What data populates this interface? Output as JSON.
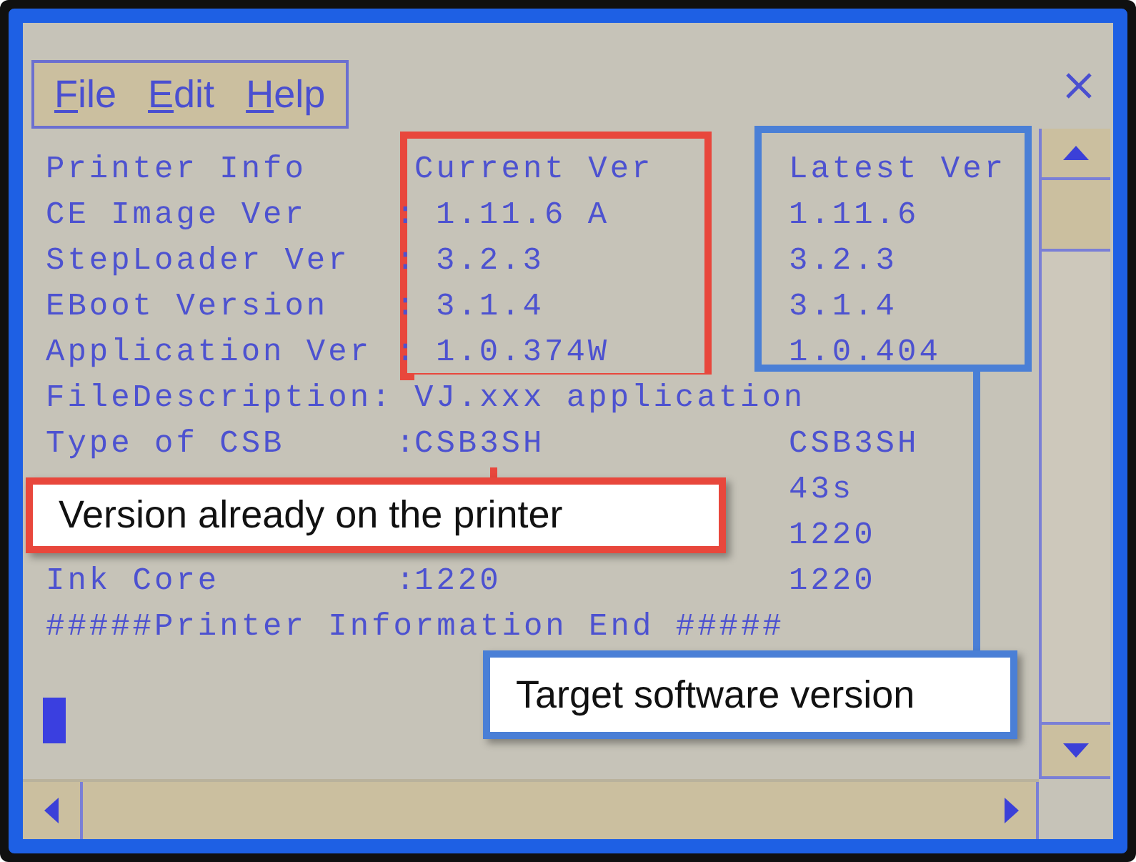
{
  "menu": [
    {
      "label": "File"
    },
    {
      "label": "Edit"
    },
    {
      "label": "Help"
    }
  ],
  "rows": [
    {
      "kind": "header",
      "label": "Printer Info",
      "current": "Current Ver",
      "latest": "Latest Ver"
    },
    {
      "kind": "version",
      "label": "CE Image Ver",
      "separator": ":",
      "current": "1.11.6 A",
      "latest": "1.11.6"
    },
    {
      "kind": "version",
      "label": "StepLoader Ver",
      "separator": ":",
      "current": "3.2.3",
      "latest": "3.2.3"
    },
    {
      "kind": "version",
      "label": "EBoot Version",
      "separator": ":",
      "current": "3.1.4",
      "latest": "3.1.4"
    },
    {
      "kind": "version",
      "label": "Application Ver",
      "separator": ":",
      "current": "1.0.374W",
      "latest": "1.0.404"
    },
    {
      "kind": "info",
      "label": "FileDescription:",
      "current": "VJ.xxx application"
    },
    {
      "kind": "info",
      "label": "Type of CSB",
      "separator": ":",
      "current": "CSB3SH",
      "latest": "CSB3SH"
    },
    {
      "kind": "info",
      "latest": "43s"
    },
    {
      "kind": "info",
      "latest": "1220"
    },
    {
      "kind": "info",
      "label": "Ink Core",
      "separator": ":",
      "current": "1220",
      "latest": "1220"
    },
    {
      "kind": "footer",
      "label": "#####Printer Information End #####"
    }
  ],
  "callouts": [
    {
      "text": "Version already on the printer",
      "color": "#e8473c"
    },
    {
      "text": "Target software version",
      "color": "#4a7fd6"
    }
  ]
}
